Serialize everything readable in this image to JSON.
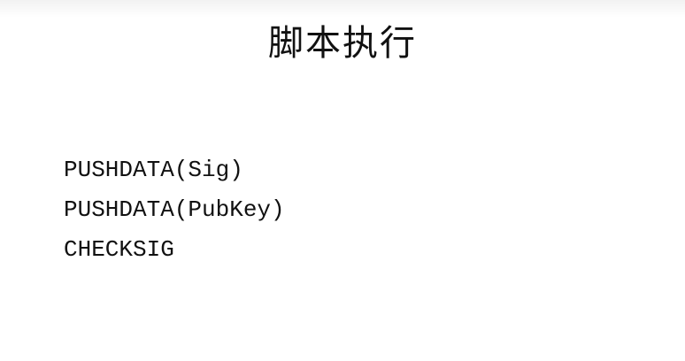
{
  "slide": {
    "title": "脚本执行",
    "code_lines": [
      "PUSHDATA(Sig)",
      "PUSHDATA(PubKey)",
      "CHECKSIG"
    ]
  }
}
